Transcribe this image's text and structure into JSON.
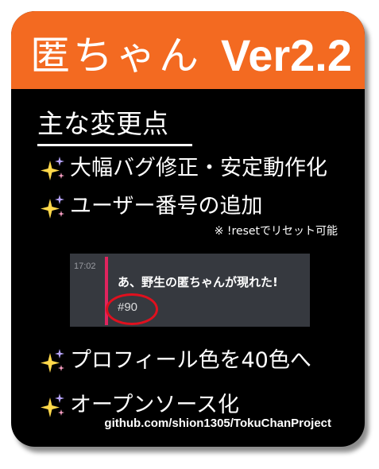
{
  "header": {
    "title_jp": "匿ちゃん",
    "version": "Ver2.2",
    "background_color": "#f36a21"
  },
  "section": {
    "title": "主な変更点"
  },
  "items": [
    {
      "icon": "sparkles-icon",
      "text": "大幅バグ修正・安定動作化"
    },
    {
      "icon": "sparkles-icon",
      "text": "ユーザー番号の追加"
    },
    {
      "icon": "sparkles-icon",
      "text": "プロフィール色を40色へ"
    },
    {
      "icon": "sparkles-icon",
      "text": "オープンソース化"
    }
  ],
  "note": "※ !resetでリセット可能",
  "chat_preview": {
    "time": "17:02",
    "message": "あ、野生の匿ちゃんが現れた!",
    "user_number": "#90",
    "accent_color": "#e0245e",
    "highlight_color": "#e0101e"
  },
  "footer": {
    "repo": "github.com/shion1305/TokuChanProject"
  }
}
